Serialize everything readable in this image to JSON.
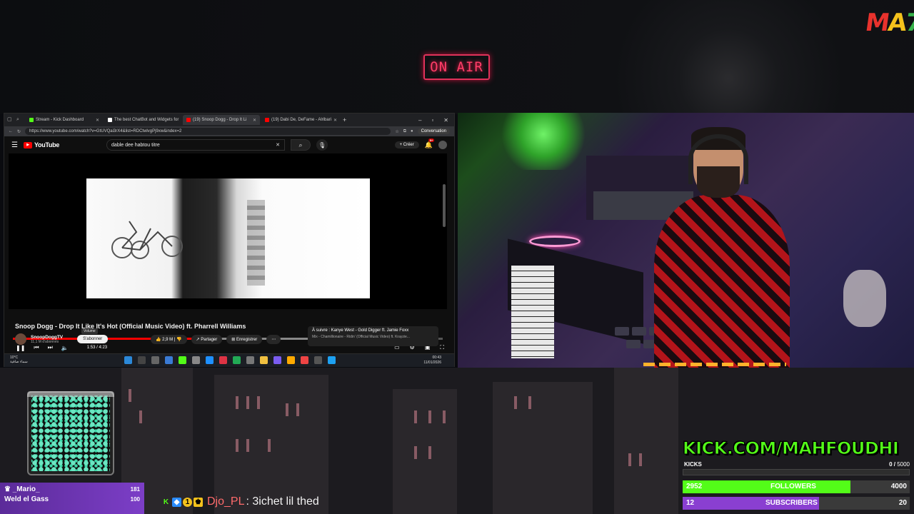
{
  "overlay": {
    "on_air": "ON AIR",
    "logo": [
      "M",
      "A",
      "7"
    ],
    "kick_url": "KICK.COM/MAHFOUDHI",
    "kicks": {
      "label": "KICKS",
      "current": "0",
      "target": "5000",
      "progress": 0
    },
    "followers": {
      "count": "2952",
      "label": "FOLLOWERS",
      "goal": "4000",
      "progress": 0.738,
      "color": "#53fc18"
    },
    "subscribers": {
      "count": "12",
      "label": "SUBSCRIBERS",
      "goal": "20",
      "progress": 0.6,
      "color": "#8a3fd1"
    }
  },
  "browser": {
    "tabs": [
      {
        "label": "Stream - Kick Dashboard",
        "color": "#53fc18",
        "active": false
      },
      {
        "label": "The best ChatBot and Widgets for",
        "color": "#ffffff",
        "active": false
      },
      {
        "label": "(19) Snoop Dogg - Drop It Li",
        "color": "#ff0000",
        "active": true
      },
      {
        "label": "(19) Dabi De, DeFame - Alribari",
        "color": "#ff0000",
        "active": false
      }
    ],
    "url": "https://www.youtube.com/watch?v=GtUVQai3rX4&list=RDCtwlvgPj9xw&index=2",
    "conversation_label": "Conversation"
  },
  "youtube": {
    "logo": "YouTube",
    "search_value": "dable dee habtou titre",
    "create_label": "Créer",
    "notif_count": "9+",
    "time": "1:53 / 4:23",
    "progress": 0.43,
    "volume_tooltip": "Volume",
    "video_title": "Snoop Dogg - Drop It Like It's Hot (Official Music Video) ft. Pharrell Williams",
    "channel": "SnoopDoggTV",
    "subscribers": "11,1 M d'abonnés",
    "subscribe_label": "S'abonner",
    "likes": "2,9 M",
    "share_label": "Partager",
    "save_label": "Enregistrer",
    "up_next": "À suivre : Kanye West - Gold Digger ft. Jamie Foxx",
    "up_next_sub": "Mix - Chamillionaire - Ridin' (Official Music Video) ft. Krayzie..."
  },
  "taskbar": {
    "weather_temp": "10°C",
    "weather_desc": "سماء صافية",
    "clock_time": "00:43",
    "clock_date": "11/01/2026"
  },
  "chat": {
    "jar_user": "_Mario_",
    "jar_user_count": "181",
    "jar_user2": "Weld el Gass",
    "jar_user2_count": "100",
    "username": "Djo_PL",
    "message": ": 3ichet lil thed"
  }
}
